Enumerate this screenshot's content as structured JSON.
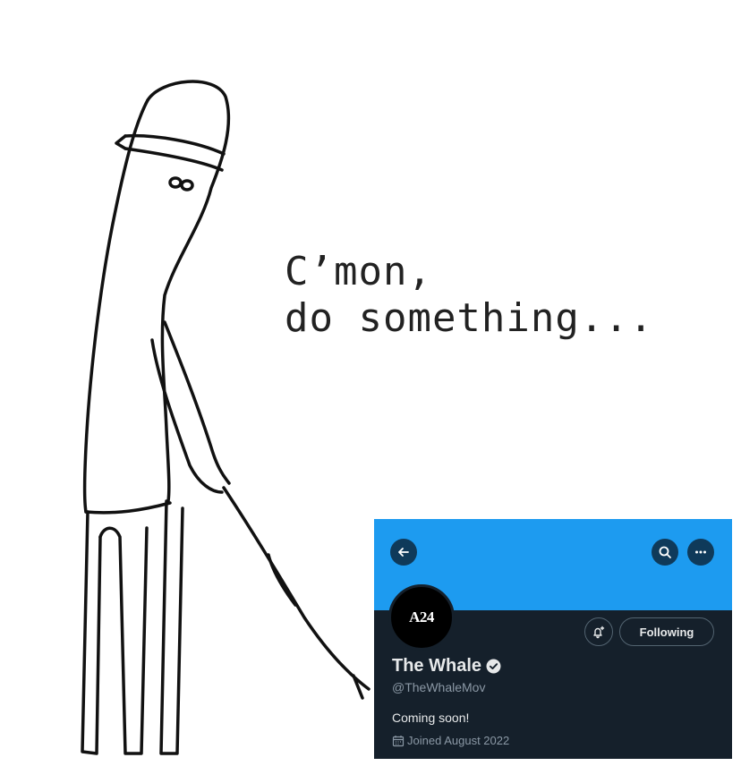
{
  "meme": {
    "caption_line1": "C’mon,",
    "caption_line2": "do something..."
  },
  "profile": {
    "avatar_text": "A24",
    "display_name": "The Whale",
    "handle": "@TheWhaleMov",
    "bio": "Coming soon!",
    "joined": "Joined August 2022",
    "follow_button": "Following",
    "verified": true,
    "icons": {
      "back": "arrow-left-icon",
      "search": "search-icon",
      "more": "more-horizontal-icon",
      "notify": "bell-plus-icon",
      "verified": "verified-badge-icon",
      "calendar": "calendar-icon"
    }
  },
  "colors": {
    "banner": "#1d9bf0",
    "card_background": "#15202b",
    "primary_text": "#e7e9ea",
    "secondary_text": "#8b98a5",
    "avatar": "#000000"
  }
}
